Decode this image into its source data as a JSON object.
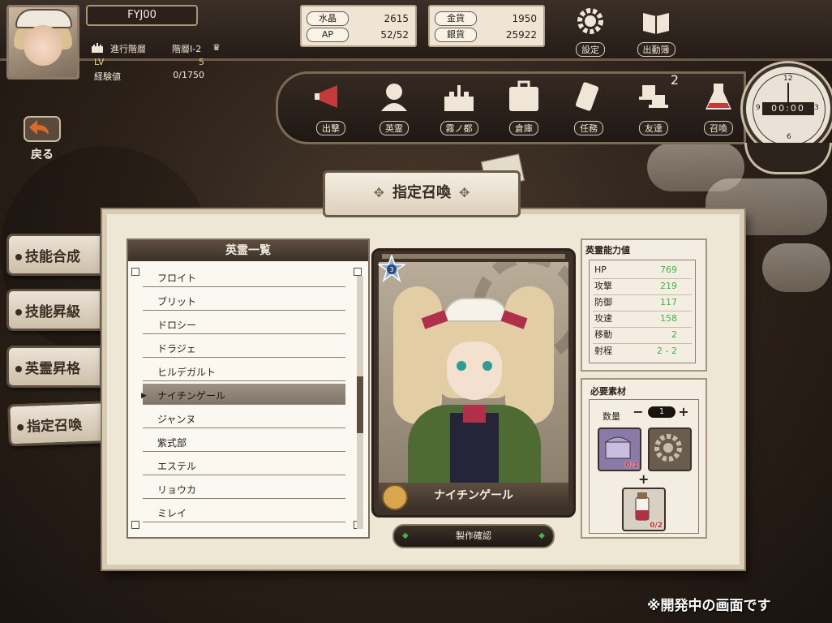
{
  "player": {
    "name": "FYJ00",
    "progress_label": "進行階層",
    "progress_value": "階層I-2",
    "lv_label": "LV",
    "lv_value": "5",
    "exp_label": "経験値",
    "exp_value": "0/1750"
  },
  "currency": {
    "crystal_label": "水晶",
    "crystal_value": "2615",
    "ap_label": "AP",
    "ap_value": "52/52",
    "gold_label": "金貨",
    "gold_value": "1950",
    "silver_label": "銀貨",
    "silver_value": "25922"
  },
  "top_buttons": {
    "settings": "設定",
    "attendance": "出勤簿"
  },
  "nav": {
    "items": [
      {
        "label": "出撃",
        "icon": "megaphone-icon"
      },
      {
        "label": "英霊",
        "icon": "bust-icon"
      },
      {
        "label": "霧ノ都",
        "icon": "castle-icon"
      },
      {
        "label": "倉庫",
        "icon": "trunk-icon"
      },
      {
        "label": "任務",
        "icon": "scroll-icon"
      },
      {
        "label": "友達",
        "icon": "hats-icon",
        "badge": "2"
      },
      {
        "label": "召喚",
        "icon": "flask-icon"
      }
    ]
  },
  "watch": {
    "counter": "00:00",
    "num12": "12",
    "num3": "3",
    "num6": "6",
    "num9": "9"
  },
  "back": {
    "label": "戻る"
  },
  "side_tabs": [
    "技能合成",
    "技能昇級",
    "英霊昇格",
    "指定召喚"
  ],
  "page_title": "指定召喚",
  "hero_list": {
    "header": "英霊一覧",
    "items": [
      "フロイト",
      "ブリット",
      "ドロシー",
      "ドラジェ",
      "ヒルデガルト",
      "ナイチンゲール",
      "ジャンヌ",
      "紫式部",
      "エステル",
      "リョウカ",
      "ミレイ"
    ],
    "selected_index": 5
  },
  "hero_card": {
    "name": "ナイチンゲール",
    "rank": "3"
  },
  "confirm_button": "製作確認",
  "stats": {
    "title": "英霊能力値",
    "rows": [
      {
        "label": "HP",
        "value": "769"
      },
      {
        "label": "攻撃",
        "value": "219"
      },
      {
        "label": "防御",
        "value": "117"
      },
      {
        "label": "攻速",
        "value": "158"
      },
      {
        "label": "移動",
        "value": "2"
      },
      {
        "label": "射程",
        "value": "2 - 2"
      }
    ]
  },
  "materials": {
    "title": "必要素材",
    "quantity_label": "数量",
    "quantity_value": "1",
    "slot1_count": "0/1",
    "slot3_count": "0/2",
    "plus": "+"
  },
  "footer_note": "※開発中の画面です",
  "colors": {
    "stat_value": "#3fb63f",
    "material_shortage": "#d02a2a",
    "accent_red": "#b0304a"
  }
}
